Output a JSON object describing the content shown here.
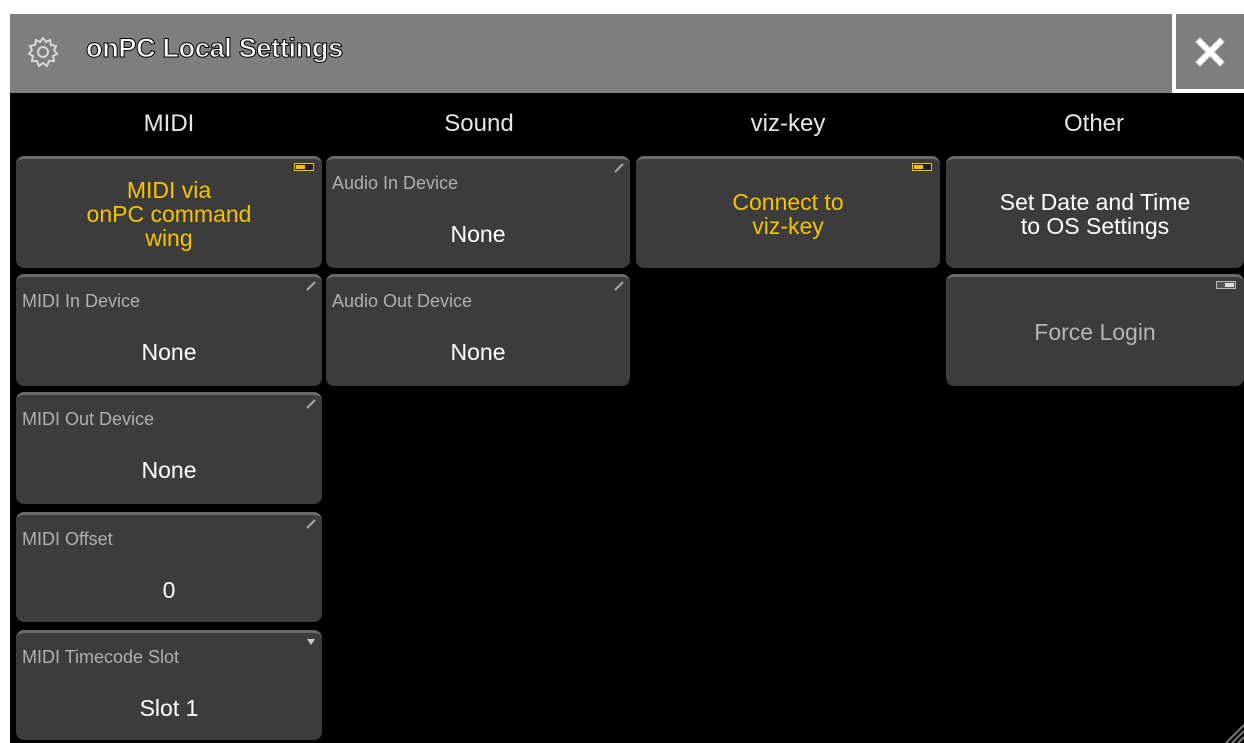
{
  "window": {
    "title": "onPC Local Settings",
    "icon": "gear-icon",
    "close_icon": "close-icon"
  },
  "columns": {
    "midi": "MIDI",
    "sound": "Sound",
    "vizkey": "viz-key",
    "other": "Other"
  },
  "midi": {
    "command_wing": "MIDI via\nonPC command\nwing",
    "in_device": {
      "label": "MIDI In Device",
      "value": "None"
    },
    "out_device": {
      "label": "MIDI Out Device",
      "value": "None"
    },
    "offset": {
      "label": "MIDI Offset",
      "value": "0"
    },
    "timecode_slot": {
      "label": "MIDI Timecode Slot",
      "value": "Slot 1"
    }
  },
  "sound": {
    "audio_in": {
      "label": "Audio In Device",
      "value": "None"
    },
    "audio_out": {
      "label": "Audio Out Device",
      "value": "None"
    }
  },
  "vizkey": {
    "connect": "Connect to\nviz-key"
  },
  "other": {
    "set_date": "Set Date and Time\nto OS Settings",
    "force_login": "Force Login"
  },
  "colors": {
    "active_text": "#f5c400",
    "tile_bg": "#3c3c3c",
    "titlebar_bg": "#7e7e7e",
    "background": "#000000"
  }
}
